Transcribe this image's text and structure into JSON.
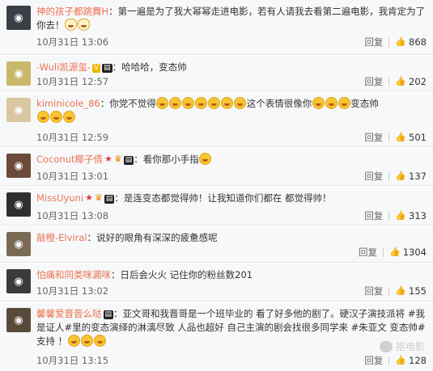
{
  "reply_label": "回复",
  "comments": [
    {
      "username": "神的孩子都跳舞H",
      "text": "：第一遍是为了我大幂幂走进电影，若有人请我去看第二遍电影，我肯定为了你去！",
      "emojis_after": 2,
      "time": "10月31日 13:06",
      "likes": "868",
      "avatar_color": "#3a3f47",
      "badges": []
    },
    {
      "username": "-Wuli凯源玺-",
      "text": "：哈哈哈，变态帅",
      "emojis_after": 0,
      "time": "10月31日 12:57",
      "likes": "202",
      "avatar_color": "#c9b86a",
      "badges": [
        "v",
        "vip"
      ]
    },
    {
      "username": "kiminicole_86",
      "text": "：你党不觉得",
      "text_mid": "这个表情很像你",
      "text_end": "变态帅",
      "time": "10月31日 12:59",
      "likes": "501",
      "avatar_color": "#d9c7a1",
      "badges": []
    },
    {
      "username": "Coconut椰子倩",
      "text": "：看你那小手指",
      "emojis_after": 1,
      "time": "10月31日 13:01",
      "likes": "137",
      "avatar_color": "#6b4a3a",
      "badges": [
        "star",
        "crown",
        "vip"
      ]
    },
    {
      "username": "MissUyuni",
      "text": "：是连变态都觉得帅！让我知道你们都在 都觉得帅！",
      "emojis_after": 0,
      "time": "10月31日 13:08",
      "likes": "313",
      "avatar_color": "#2f2f2f",
      "badges": [
        "star",
        "crown",
        "vip"
      ]
    },
    {
      "username": "敲橙-Elviral",
      "text": "：说好的眼角有深深的疲惫感呢",
      "emojis_after": 0,
      "time": "",
      "likes": "1304",
      "avatar_color": "#7a6a55",
      "badges": []
    },
    {
      "username": "怕痛和同类咪漏咪",
      "text": "：日后会火火 记住你的粉丝数201",
      "emojis_after": 0,
      "time": "10月31日 13:02",
      "likes": "155",
      "avatar_color": "#3b3b3b",
      "badges": []
    },
    {
      "username": "馨馨爱晋晋么哒",
      "text": "：亚文哥和我晋哥是一个班毕业的 看了好多他的剧了。硬汉子演技派将 #我是证人#里的变态演绎的淋漓尽致 人品也超好 自己主演的剧会找很多同学来 #朱亚文 变态帅#支持 ！",
      "emojis_after": 3,
      "time": "10月31日 13:15",
      "likes": "128",
      "avatar_color": "#5a4a3a",
      "badges": [
        "vip"
      ]
    }
  ],
  "watermark": "抠电影"
}
